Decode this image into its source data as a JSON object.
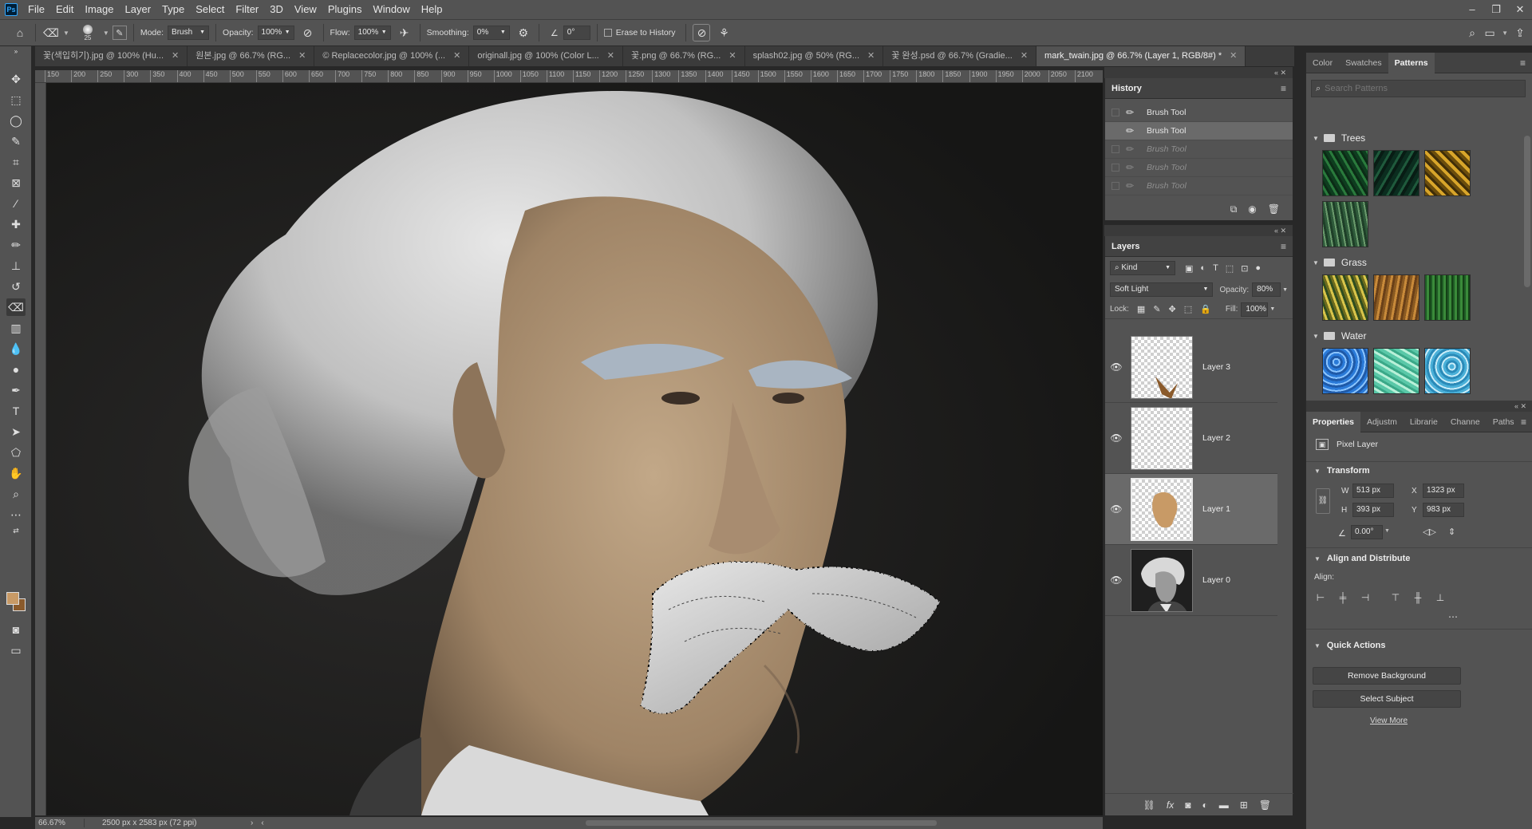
{
  "menubar": {
    "items": [
      "File",
      "Edit",
      "Image",
      "Layer",
      "Type",
      "Select",
      "Filter",
      "3D",
      "View",
      "Plugins",
      "Window",
      "Help"
    ]
  },
  "options": {
    "brush_size": "25",
    "mode_label": "Mode:",
    "mode_value": "Brush",
    "opacity_label": "Opacity:",
    "opacity_value": "100%",
    "flow_label": "Flow:",
    "flow_value": "100%",
    "smoothing_label": "Smoothing:",
    "smoothing_value": "0%",
    "angle_value": "0°",
    "erase_history_label": "Erase to History"
  },
  "tabs": [
    {
      "label": "꽃(색입히기).jpg @ 100% (Hu..."
    },
    {
      "label": "원본.jpg @ 66.7% (RG..."
    },
    {
      "label": "© Replacecolor.jpg @ 100% (..."
    },
    {
      "label": "originall.jpg @ 100% (Color L..."
    },
    {
      "label": "꽃.png @ 66.7% (RG..."
    },
    {
      "label": "splash02.jpg @ 50% (RG..."
    },
    {
      "label": "꽃 완성.psd @ 66.7% (Gradie..."
    },
    {
      "label": "mark_twain.jpg @ 66.7% (Layer 1, RGB/8#) *"
    }
  ],
  "ruler": {
    "ticks": [
      "150",
      "200",
      "250",
      "300",
      "350",
      "400",
      "450",
      "500",
      "550",
      "600",
      "650",
      "700",
      "750",
      "800",
      "850",
      "900",
      "950",
      "1000",
      "1050",
      "1100",
      "1150",
      "1200",
      "1250",
      "1300",
      "1350",
      "1400",
      "1450",
      "1500",
      "1550",
      "1600",
      "1650",
      "1700",
      "1750",
      "1800",
      "1850",
      "1900",
      "1950",
      "2000",
      "2050",
      "2100"
    ]
  },
  "status": {
    "zoom": "66.67%",
    "dimensions": "2500 px x 2583 px (72 ppi)"
  },
  "history": {
    "title": "History",
    "items": [
      "Brush Tool",
      "Brush Tool",
      "Brush Tool",
      "Brush Tool",
      "Brush Tool"
    ]
  },
  "layers": {
    "title": "Layers",
    "kind_label": "Kind",
    "blend_mode": "Soft Light",
    "opacity_label": "Opacity:",
    "opacity_value": "80%",
    "lock_label": "Lock:",
    "fill_label": "Fill:",
    "fill_value": "100%",
    "items": [
      {
        "name": "Layer 3"
      },
      {
        "name": "Layer 2"
      },
      {
        "name": "Layer 1"
      },
      {
        "name": "Layer 0"
      }
    ]
  },
  "patterns_panel": {
    "tabs": [
      "Color",
      "Swatches",
      "Patterns"
    ],
    "search_placeholder": "Search Patterns",
    "groups": [
      "Trees",
      "Grass",
      "Water"
    ]
  },
  "properties": {
    "tabs": [
      "Properties",
      "Adjustm",
      "Librarie",
      "Channe",
      "Paths"
    ],
    "layer_type": "Pixel Layer",
    "transform_label": "Transform",
    "w_label": "W",
    "w_value": "513 px",
    "h_label": "H",
    "h_value": "393 px",
    "x_label": "X",
    "x_value": "1323 px",
    "y_label": "Y",
    "y_value": "983 px",
    "angle_value": "0.00°",
    "align_distribute_label": "Align and Distribute",
    "align_label": "Align:",
    "quick_actions_label": "Quick Actions",
    "remove_bg_label": "Remove Background",
    "select_subject_label": "Select Subject",
    "view_more_label": "View More"
  },
  "colors": {
    "foreground": "#c89a66",
    "background": "#8a5a2b",
    "skin_tone": "#b59a7c"
  }
}
